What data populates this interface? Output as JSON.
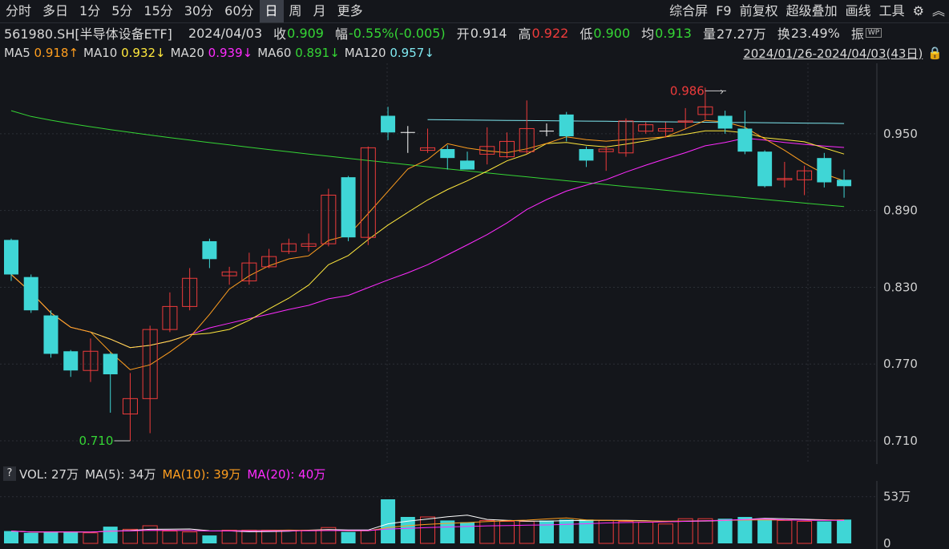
{
  "toolbar": {
    "periods": [
      "分时",
      "多日",
      "1分",
      "5分",
      "15分",
      "30分",
      "60分",
      "日",
      "周",
      "月",
      "更多"
    ],
    "active_period": "日",
    "right_items": [
      "综合屏",
      "F9",
      "前复权",
      "超级叠加",
      "画线",
      "工具"
    ]
  },
  "info": {
    "code_name": "561980.SH[半导体设备ETF]",
    "date": "2024/04/03",
    "close_label": "收",
    "close": "0.909",
    "change_label": "幅",
    "change": "-0.55%(-0.005)",
    "open_label": "开",
    "open": "0.914",
    "high_label": "高",
    "high": "0.922",
    "low_label": "低",
    "low": "0.900",
    "avg_label": "均",
    "avg": "0.913",
    "volume_label": "量",
    "volume": "27.27万",
    "turnover_label": "换",
    "turnover": "23.49%",
    "amplitude_label": "振"
  },
  "ma": [
    {
      "label": "MA5",
      "value": "0.918",
      "arrow": "↑",
      "color": "#ff9e1f"
    },
    {
      "label": "MA10",
      "value": "0.932",
      "arrow": "↓",
      "color": "#ffe83d"
    },
    {
      "label": "MA20",
      "value": "0.939",
      "arrow": "↓",
      "color": "#ff2bff"
    },
    {
      "label": "MA60",
      "value": "0.891",
      "arrow": "↓",
      "color": "#35d535"
    },
    {
      "label": "MA120",
      "value": "0.957",
      "arrow": "↓",
      "color": "#7fe8f0"
    }
  ],
  "range_label": "2024/01/26-2024/04/03(43日)",
  "volume_row": {
    "question": "?",
    "vol": "VOL: 27万",
    "ma5": "MA(5): 34万",
    "ma10": "MA(10): 39万",
    "ma20": "MA(20): 40万",
    "ma10_color": "#ff9e1f",
    "ma20_color": "#ff2bff"
  },
  "colors": {
    "up": "#ee3b3b",
    "down": "#3fd6d6",
    "ma5": "#ffffff",
    "ma10": "#ff9e1f",
    "ma20": "#ffe83d",
    "ma60": "#35d535",
    "ma120": "#7fe8f0",
    "ma_mag": "#ff2bff"
  },
  "chart_data": {
    "type": "candlestick",
    "ylim": [
      0.695,
      1.0
    ],
    "y_ticks": [
      "0.950",
      "0.890",
      "0.830",
      "0.770",
      "0.710"
    ],
    "high_marker": "0.986",
    "low_marker": "0.710",
    "candles": [
      {
        "o": 0.867,
        "c": 0.84,
        "h": 0.868,
        "l": 0.835
      },
      {
        "o": 0.838,
        "c": 0.812,
        "h": 0.84,
        "l": 0.81
      },
      {
        "o": 0.808,
        "c": 0.778,
        "h": 0.812,
        "l": 0.775
      },
      {
        "o": 0.78,
        "c": 0.765,
        "h": 0.781,
        "l": 0.76
      },
      {
        "o": 0.765,
        "c": 0.78,
        "h": 0.79,
        "l": 0.756
      },
      {
        "o": 0.778,
        "c": 0.762,
        "h": 0.779,
        "l": 0.732
      },
      {
        "o": 0.731,
        "c": 0.743,
        "h": 0.763,
        "l": 0.71
      },
      {
        "o": 0.743,
        "c": 0.797,
        "h": 0.8,
        "l": 0.716
      },
      {
        "o": 0.797,
        "c": 0.815,
        "h": 0.826,
        "l": 0.795
      },
      {
        "o": 0.815,
        "c": 0.837,
        "h": 0.845,
        "l": 0.812
      },
      {
        "o": 0.866,
        "c": 0.852,
        "h": 0.868,
        "l": 0.845
      },
      {
        "o": 0.839,
        "c": 0.842,
        "h": 0.846,
        "l": 0.832
      },
      {
        "o": 0.835,
        "c": 0.849,
        "h": 0.857,
        "l": 0.832
      },
      {
        "o": 0.846,
        "c": 0.854,
        "h": 0.86,
        "l": 0.845
      },
      {
        "o": 0.858,
        "c": 0.864,
        "h": 0.868,
        "l": 0.856
      },
      {
        "o": 0.862,
        "c": 0.864,
        "h": 0.872,
        "l": 0.858
      },
      {
        "o": 0.864,
        "c": 0.902,
        "h": 0.907,
        "l": 0.862
      },
      {
        "o": 0.916,
        "c": 0.869,
        "h": 0.917,
        "l": 0.866
      },
      {
        "o": 0.869,
        "c": 0.939,
        "h": 0.94,
        "l": 0.863
      },
      {
        "o": 0.964,
        "c": 0.951,
        "h": 0.971,
        "l": 0.945
      },
      {
        "o": 0.951,
        "c": 0.951,
        "h": 0.956,
        "l": 0.935
      },
      {
        "o": 0.937,
        "c": 0.939,
        "h": 0.954,
        "l": 0.935
      },
      {
        "o": 0.938,
        "c": 0.931,
        "h": 0.941,
        "l": 0.922
      },
      {
        "o": 0.929,
        "c": 0.922,
        "h": 0.936,
        "l": 0.922
      },
      {
        "o": 0.934,
        "c": 0.94,
        "h": 0.955,
        "l": 0.926
      },
      {
        "o": 0.932,
        "c": 0.944,
        "h": 0.951,
        "l": 0.931
      },
      {
        "o": 0.936,
        "c": 0.954,
        "h": 0.976,
        "l": 0.934
      },
      {
        "o": 0.952,
        "c": 0.952,
        "h": 0.958,
        "l": 0.948
      },
      {
        "o": 0.965,
        "c": 0.948,
        "h": 0.967,
        "l": 0.944
      },
      {
        "o": 0.938,
        "c": 0.929,
        "h": 0.94,
        "l": 0.924
      },
      {
        "o": 0.936,
        "c": 0.938,
        "h": 0.94,
        "l": 0.921
      },
      {
        "o": 0.935,
        "c": 0.96,
        "h": 0.962,
        "l": 0.932
      },
      {
        "o": 0.952,
        "c": 0.957,
        "h": 0.959,
        "l": 0.95
      },
      {
        "o": 0.952,
        "c": 0.954,
        "h": 0.959,
        "l": 0.947
      },
      {
        "o": 0.959,
        "c": 0.96,
        "h": 0.97,
        "l": 0.954
      },
      {
        "o": 0.965,
        "c": 0.971,
        "h": 0.986,
        "l": 0.961
      },
      {
        "o": 0.964,
        "c": 0.954,
        "h": 0.968,
        "l": 0.95
      },
      {
        "o": 0.954,
        "c": 0.936,
        "h": 0.968,
        "l": 0.934
      },
      {
        "o": 0.936,
        "c": 0.909,
        "h": 0.937,
        "l": 0.908
      },
      {
        "o": 0.914,
        "c": 0.915,
        "h": 0.928,
        "l": 0.908
      },
      {
        "o": 0.914,
        "c": 0.921,
        "h": 0.925,
        "l": 0.902
      },
      {
        "o": 0.931,
        "c": 0.912,
        "h": 0.935,
        "l": 0.908
      },
      {
        "o": 0.914,
        "c": 0.909,
        "h": 0.922,
        "l": 0.9
      }
    ],
    "volume": {
      "ylim": [
        0,
        60
      ],
      "y_ticks": [
        "53万",
        "0"
      ],
      "values": [
        14,
        12,
        13,
        13,
        12,
        19,
        16,
        20,
        14,
        13,
        9,
        15,
        15,
        15,
        15,
        15,
        18,
        13,
        15,
        50,
        30,
        30,
        26,
        24,
        26,
        25,
        25,
        26,
        27,
        27,
        26,
        25,
        24,
        22,
        28,
        28,
        28,
        30,
        28,
        26,
        25,
        25,
        27
      ]
    }
  }
}
